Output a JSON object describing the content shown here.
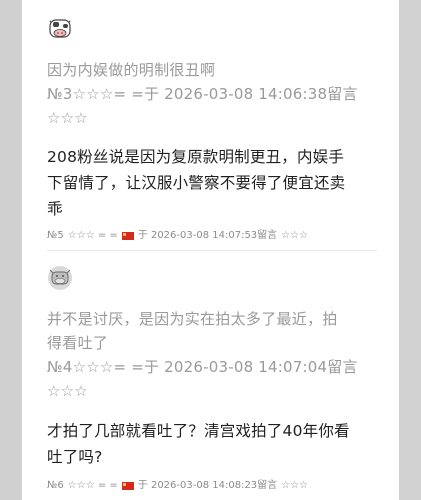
{
  "comments": [
    {
      "quote_text": "因为内娱做的明制很丑啊",
      "quote_meta_line1": "№3☆☆☆= =于 2026-03-08 14:06:38留言",
      "quote_meta_line2": "☆☆☆",
      "reply_line1": "208粉丝说是因为复原款明制更丑，内娱手",
      "reply_line2": "下留情了，让汉服小警察不要得了便宜还卖",
      "reply_line3": "乖",
      "meta_no": "№5",
      "meta_stars_before": "☆☆☆ = =",
      "meta_flag": "cn-flag",
      "meta_time": "于 2026-03-08 14:07:53留言",
      "meta_stars_after": "☆☆☆"
    },
    {
      "quote_text_line1": "并不是讨厌，是因为实在拍太多了最近，拍",
      "quote_text_line2": "得看吐了",
      "quote_meta_line1": "№4☆☆☆= =于 2026-03-08 14:07:04留言",
      "quote_meta_line2": "☆☆☆",
      "reply_line1": "才拍了几部就看吐了？清宫戏拍了40年你看",
      "reply_line2": "吐了吗?",
      "meta_no": "№6",
      "meta_stars_before": "☆☆☆ = =",
      "meta_flag": "cn-flag",
      "meta_time": "于 2026-03-08 14:08:23留言",
      "meta_stars_after": "☆☆☆"
    }
  ],
  "icons": {
    "avatar1": "cow-avatar-icon",
    "avatar2": "cow-avatar-icon"
  }
}
